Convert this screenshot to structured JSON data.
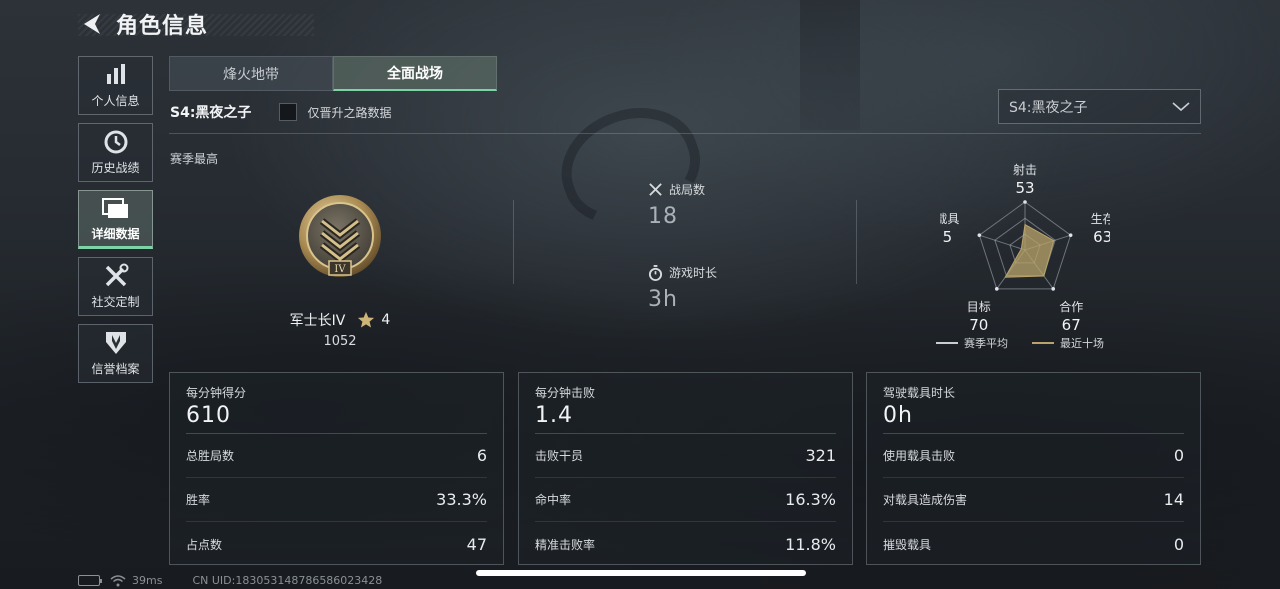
{
  "header": {
    "title": "角色信息"
  },
  "sidebar": {
    "items": [
      {
        "label": "个人信息",
        "icon": "bar-chart-icon"
      },
      {
        "label": "历史战绩",
        "icon": "history-icon"
      },
      {
        "label": "详细数据",
        "icon": "folder-icon",
        "active": true
      },
      {
        "label": "社交定制",
        "icon": "tools-icon"
      },
      {
        "label": "信誉档案",
        "icon": "shield-badge-icon"
      }
    ]
  },
  "tabs": [
    {
      "label": "烽火地带",
      "active": false
    },
    {
      "label": "全面战场",
      "active": true
    }
  ],
  "season": {
    "label": "S4:黑夜之子",
    "checkbox_label": "仅晋升之路数据",
    "checked": false,
    "select_value": "S4:黑夜之子"
  },
  "season_best": {
    "section_label": "赛季最高",
    "rank_name": "军士长IV",
    "rank_badge": "IV",
    "stars": "4",
    "points": "1052"
  },
  "summary": {
    "matches_label": "战局数",
    "matches_value": "18",
    "playtime_label": "游戏时长",
    "playtime_value": "3h"
  },
  "radar": {
    "axes": [
      {
        "label": "射击",
        "value": "53"
      },
      {
        "label": "生存",
        "value": "63"
      },
      {
        "label": "合作",
        "value": "67"
      },
      {
        "label": "目标",
        "value": "70"
      },
      {
        "label": "载具",
        "value": "5"
      }
    ],
    "legend_avg": "赛季平均",
    "legend_recent": "最近十场",
    "colors": {
      "avg": "#c9ced3",
      "recent": "#b9a36a"
    }
  },
  "cards": [
    {
      "title": "每分钟得分",
      "big": "610",
      "rows": [
        {
          "label": "总胜局数",
          "value": "6"
        },
        {
          "label": "胜率",
          "value": "33.3%"
        },
        {
          "label": "占点数",
          "value": "47"
        }
      ]
    },
    {
      "title": "每分钟击败",
      "big": "1.4",
      "rows": [
        {
          "label": "击败干员",
          "value": "321"
        },
        {
          "label": "命中率",
          "value": "16.3%"
        },
        {
          "label": "精准击败率",
          "value": "11.8%"
        }
      ]
    },
    {
      "title": "驾驶载具时长",
      "big": "0h",
      "rows": [
        {
          "label": "使用载具击败",
          "value": "0"
        },
        {
          "label": "对载具造成伤害",
          "value": "14"
        },
        {
          "label": "摧毁载具",
          "value": "0"
        }
      ]
    }
  ],
  "status": {
    "ping": "39ms",
    "uid": "CN UID:1830531487865860234​28"
  },
  "accent_color": "#7cd3a6"
}
